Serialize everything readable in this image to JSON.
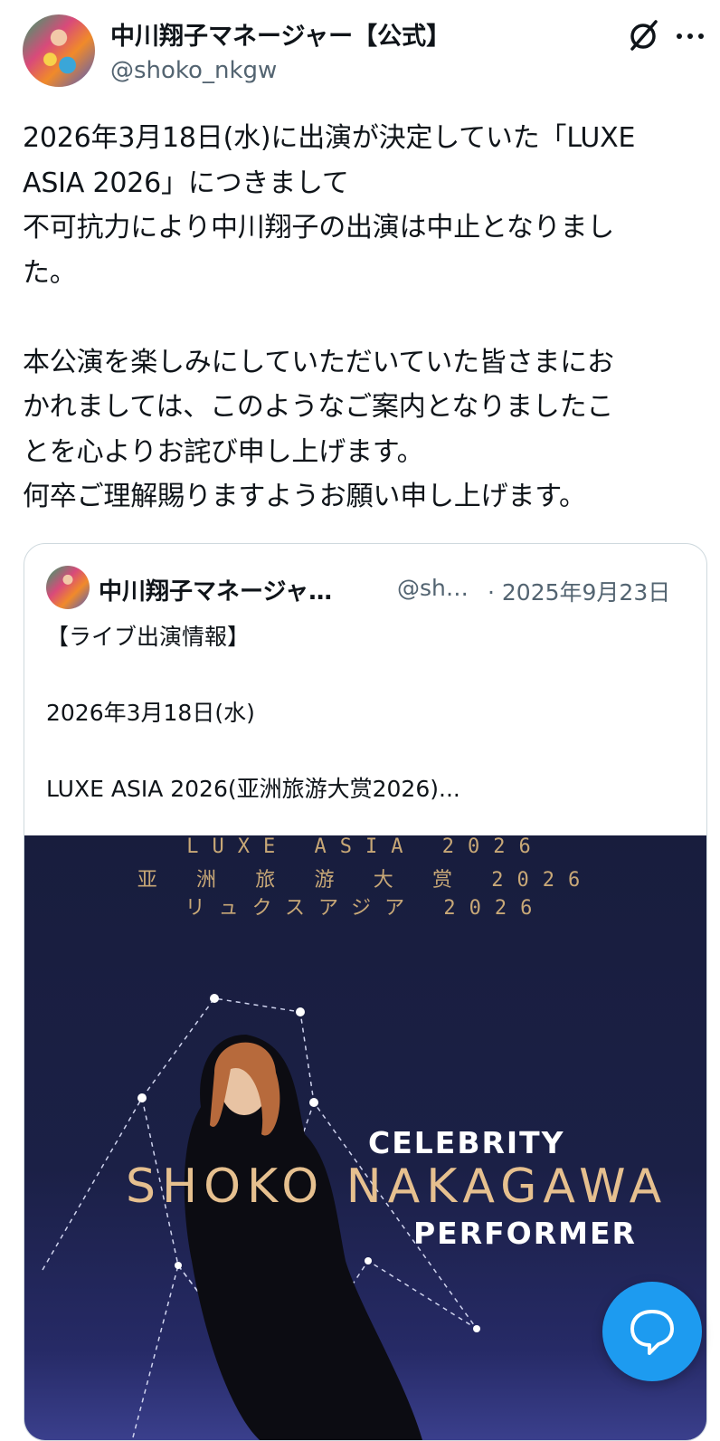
{
  "author": {
    "name": "中川翔子マネージャー【公式】",
    "handle": "@shoko_nkgw"
  },
  "icons": {
    "grok": "grok-icon",
    "more": "more-icon",
    "compose": "message-icon"
  },
  "tweet": {
    "lines": [
      "2026年3月18日(水)に出演が決定していた「LUXE",
      "ASIA 2026」につきまして",
      "不可抗力により中川翔子の出演は中止となりまし",
      "た。",
      "",
      "本公演を楽しみにしていただいていた皆さまにお",
      "かれましては、このようなご案内となりましたこ",
      "とを心よりお詫び申し上げます。",
      "何卒ご理解賜りますようお願い申し上げます。"
    ]
  },
  "quote": {
    "name": "中川翔子マネージャ…",
    "handle": "@sh…",
    "date": "· 2025年9月23日",
    "body": [
      "【ライブ出演情報】",
      "",
      "2026年3月18日(水)",
      "",
      "LUXE ASIA 2026(亚洲旅游大赏2026)..."
    ],
    "media": {
      "line1": "LUXE ASIA 2026",
      "line2": "亚 洲 旅 游 大 赏  2026",
      "line3": "リュクスアジア 2026",
      "celebrity": "CELEBRITY",
      "performer_name": "SHOKO NAKAGAWA",
      "performer": "PERFORMER"
    }
  },
  "colors": {
    "accent": "#1d9bf0",
    "secondary_text": "#536471",
    "border": "#cfd9de",
    "poster_bg": "#1b2046",
    "poster_gold": "#c8a877"
  }
}
